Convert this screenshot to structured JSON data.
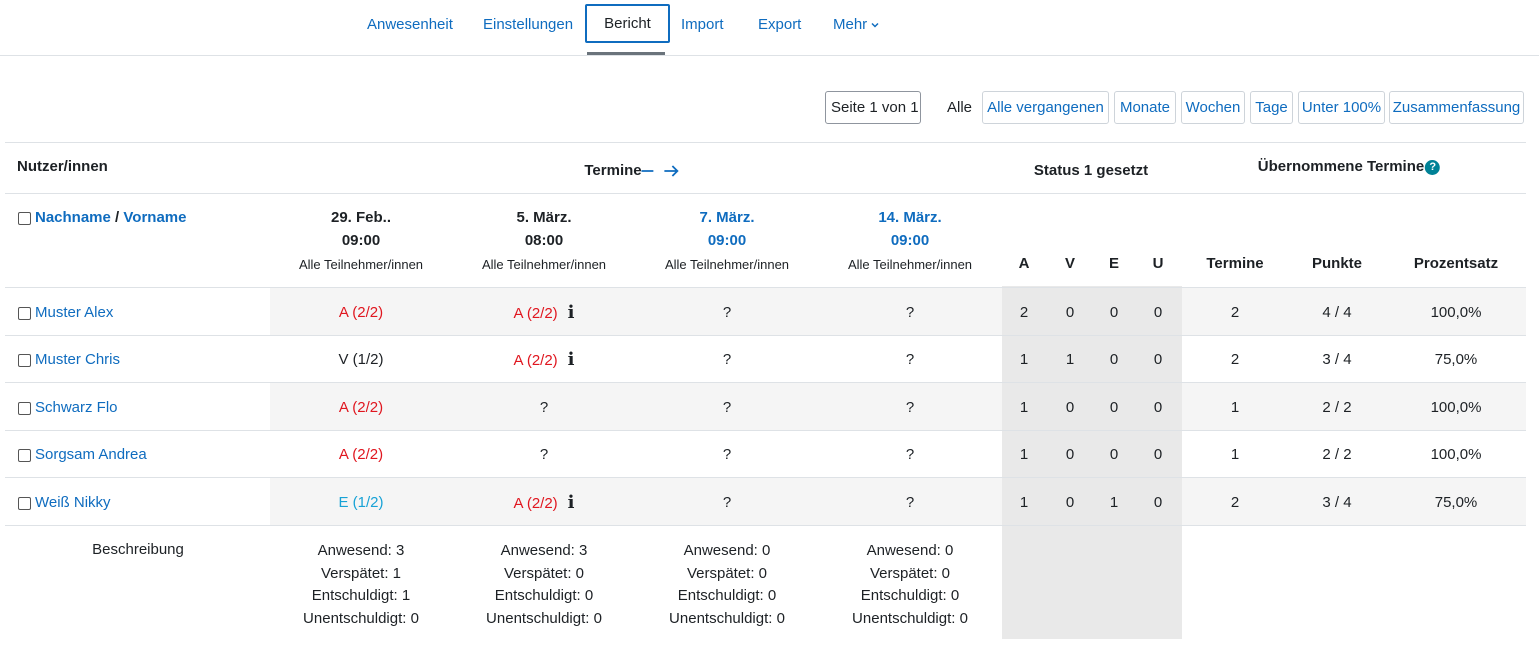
{
  "nav": {
    "items": [
      "Anwesenheit",
      "Einstellungen",
      "Import",
      "Export"
    ],
    "active": "Bericht",
    "more": "Mehr"
  },
  "filters": {
    "page": "Seite 1 von 1",
    "all": "Alle",
    "buttons": [
      "Alle vergangenen",
      "Monate",
      "Wochen",
      "Tage",
      "Unter 100%",
      "Zusammenfassung"
    ]
  },
  "table": {
    "users_header": "Nutzer/innen",
    "sessions_header": "Termine",
    "status_header": "Status 1 gesetzt",
    "taken_header": "Übernommene Termine",
    "lastname": "Nachname",
    "sep": "/",
    "firstname": "Vorname",
    "sessions": [
      {
        "date": "29. Feb..",
        "time": "09:00",
        "group": "Alle Teilnehmer/innen"
      },
      {
        "date": "5. März.",
        "time": "08:00",
        "group": "Alle Teilnehmer/innen"
      },
      {
        "date": "7. März.",
        "time": "09:00",
        "group": "Alle Teilnehmer/innen"
      },
      {
        "date": "14. März.",
        "time": "09:00",
        "group": "Alle Teilnehmer/innen"
      }
    ],
    "status_cols": [
      "A",
      "V",
      "E",
      "U"
    ],
    "taken_cols": [
      "Termine",
      "Punkte",
      "Prozentsatz"
    ],
    "rows": [
      {
        "name": "Muster Alex",
        "s": [
          "A (2/2)",
          "A (2/2)",
          "?",
          "?"
        ],
        "counts": [
          "2",
          "0",
          "0",
          "0"
        ],
        "termine": "2",
        "punkte": "4 / 4",
        "prozent": "100,0%"
      },
      {
        "name": "Muster Chris",
        "s": [
          "V (1/2)",
          "A (2/2)",
          "?",
          "?"
        ],
        "counts": [
          "1",
          "1",
          "0",
          "0"
        ],
        "termine": "2",
        "punkte": "3 / 4",
        "prozent": "75,0%"
      },
      {
        "name": "Schwarz Flo",
        "s": [
          "A (2/2)",
          "?",
          "?",
          "?"
        ],
        "counts": [
          "1",
          "0",
          "0",
          "0"
        ],
        "termine": "1",
        "punkte": "2 / 2",
        "prozent": "100,0%"
      },
      {
        "name": "Sorgsam Andrea",
        "s": [
          "A (2/2)",
          "?",
          "?",
          "?"
        ],
        "counts": [
          "1",
          "0",
          "0",
          "0"
        ],
        "termine": "1",
        "punkte": "2 / 2",
        "prozent": "100,0%"
      },
      {
        "name": "Weiß Nikky",
        "s": [
          "E (1/2)",
          "A (2/2)",
          "?",
          "?"
        ],
        "counts": [
          "1",
          "0",
          "1",
          "0"
        ],
        "termine": "2",
        "punkte": "3 / 4",
        "prozent": "75,0%"
      }
    ],
    "summary_label": "Beschreibung",
    "summary": [
      [
        "Anwesend: 3",
        "Verspätet: 1",
        "Entschuldigt: 1",
        "Unentschuldigt: 0"
      ],
      [
        "Anwesend: 3",
        "Verspätet: 0",
        "Entschuldigt: 0",
        "Unentschuldigt: 0"
      ],
      [
        "Anwesend: 0",
        "Verspätet: 0",
        "Entschuldigt: 0",
        "Unentschuldigt: 0"
      ],
      [
        "Anwesend: 0",
        "Verspätet: 0",
        "Entschuldigt: 0",
        "Unentschuldigt: 0"
      ]
    ]
  }
}
